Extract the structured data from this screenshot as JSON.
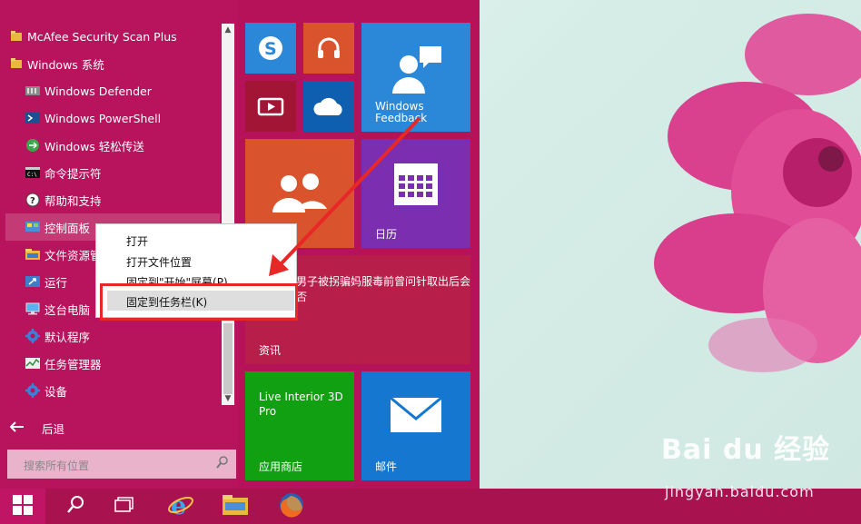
{
  "apps": [
    {
      "label": "McAfee Security Scan Plus",
      "icon": "folder-icon",
      "group": true
    },
    {
      "label": "Windows 系统",
      "icon": "folder-icon",
      "group": true
    },
    {
      "label": "Windows Defender",
      "icon": "defender-icon"
    },
    {
      "label": "Windows PowerShell",
      "icon": "powershell-icon"
    },
    {
      "label": "Windows 轻松传送",
      "icon": "easy-transfer-icon"
    },
    {
      "label": "命令提示符",
      "icon": "cmd-icon"
    },
    {
      "label": "帮助和支持",
      "icon": "help-icon"
    },
    {
      "label": "控制面板",
      "icon": "control-panel-icon"
    },
    {
      "label": "文件资源管",
      "icon": "file-explorer-icon"
    },
    {
      "label": "运行",
      "icon": "run-icon"
    },
    {
      "label": "这台电脑",
      "icon": "this-pc-icon"
    },
    {
      "label": "默认程序",
      "icon": "gear-icon"
    },
    {
      "label": "任务管理器",
      "icon": "task-manager-icon"
    },
    {
      "label": "设备",
      "icon": "gear-icon"
    }
  ],
  "back_label": "后退",
  "search": {
    "placeholder": "搜索所有位置"
  },
  "tiles": {
    "windows_feedback": "Windows\nFeedback",
    "calendar": "日历",
    "news_headline": "男子被拐骗妈服毒前曾问针取出后会否",
    "news": "资讯",
    "live_interior": "Live Interior 3D\nPro",
    "store": "应用商店",
    "mail": "邮件"
  },
  "context_menu": {
    "open": "打开",
    "open_location": "打开文件位置",
    "pin_start": "固定到\"开始\"屏幕(P)",
    "pin_taskbar": "固定到任务栏(K)"
  },
  "watermark": {
    "logo": "Bai du 经验",
    "url": "jingyan.baidu.com"
  },
  "colors": {
    "start_bg": "#b8145d",
    "tile_blue": "#2b88d8",
    "tile_orange": "#d9532c",
    "tile_purple": "#7b2fb0",
    "tile_green": "#10a011",
    "tile_news": "#b71f4a",
    "highlight": "#e82727"
  }
}
